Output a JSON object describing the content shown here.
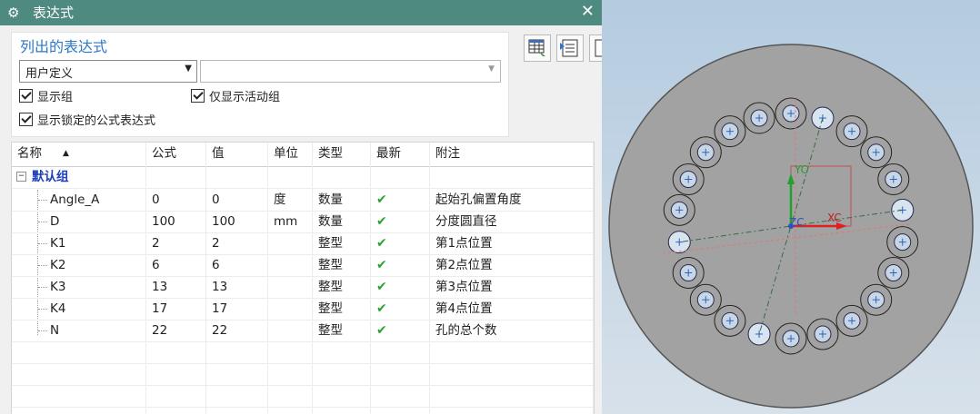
{
  "window": {
    "title": "表达式"
  },
  "filter": {
    "section_title": "列出的表达式",
    "dropdown_value": "用户定义",
    "dropdown2_value": "",
    "checkboxes": [
      {
        "label": "显示组",
        "checked": true
      },
      {
        "label": "仅显示活动组",
        "checked": true
      },
      {
        "label": "显示锁定的公式表达式",
        "checked": true
      }
    ]
  },
  "table": {
    "headers": [
      "名称",
      "公式",
      "值",
      "单位",
      "类型",
      "最新",
      "附注"
    ],
    "group": "默认组",
    "rows": [
      {
        "name": "Angle_A",
        "formula": "0",
        "value": "0",
        "unit": "度",
        "type": "数量",
        "latest": "✔",
        "note": "起始孔偏置角度"
      },
      {
        "name": "D",
        "formula": "100",
        "value": "100",
        "unit": "mm",
        "type": "数量",
        "latest": "✔",
        "note": "分度圆直径"
      },
      {
        "name": "K1",
        "formula": "2",
        "value": "2",
        "unit": "",
        "type": "整型",
        "latest": "✔",
        "note": "第1点位置"
      },
      {
        "name": "K2",
        "formula": "6",
        "value": "6",
        "unit": "",
        "type": "整型",
        "latest": "✔",
        "note": "第2点位置"
      },
      {
        "name": "K3",
        "formula": "13",
        "value": "13",
        "unit": "",
        "type": "整型",
        "latest": "✔",
        "note": "第3点位置"
      },
      {
        "name": "K4",
        "formula": "17",
        "value": "17",
        "unit": "",
        "type": "整型",
        "latest": "✔",
        "note": "第4点位置"
      },
      {
        "name": "N",
        "formula": "22",
        "value": "22",
        "unit": "",
        "type": "整型",
        "latest": "✔",
        "note": "孔的总个数"
      }
    ]
  },
  "viewport": {
    "axis_labels": {
      "x": "XC",
      "y": "YC",
      "z": "ZC"
    },
    "hole_count": 22,
    "highlighted_positions": [
      2,
      6,
      13,
      17
    ]
  },
  "colors": {
    "titlebar": "#4e8a80",
    "accent": "#2e78c9",
    "group": "#1d3fb8",
    "check": "#2aa52a",
    "disk": "#a2a2a2"
  },
  "icons": {
    "title": "gear-icon",
    "close": "close-icon",
    "sort": "sort-up-icon",
    "check": "check-icon"
  }
}
